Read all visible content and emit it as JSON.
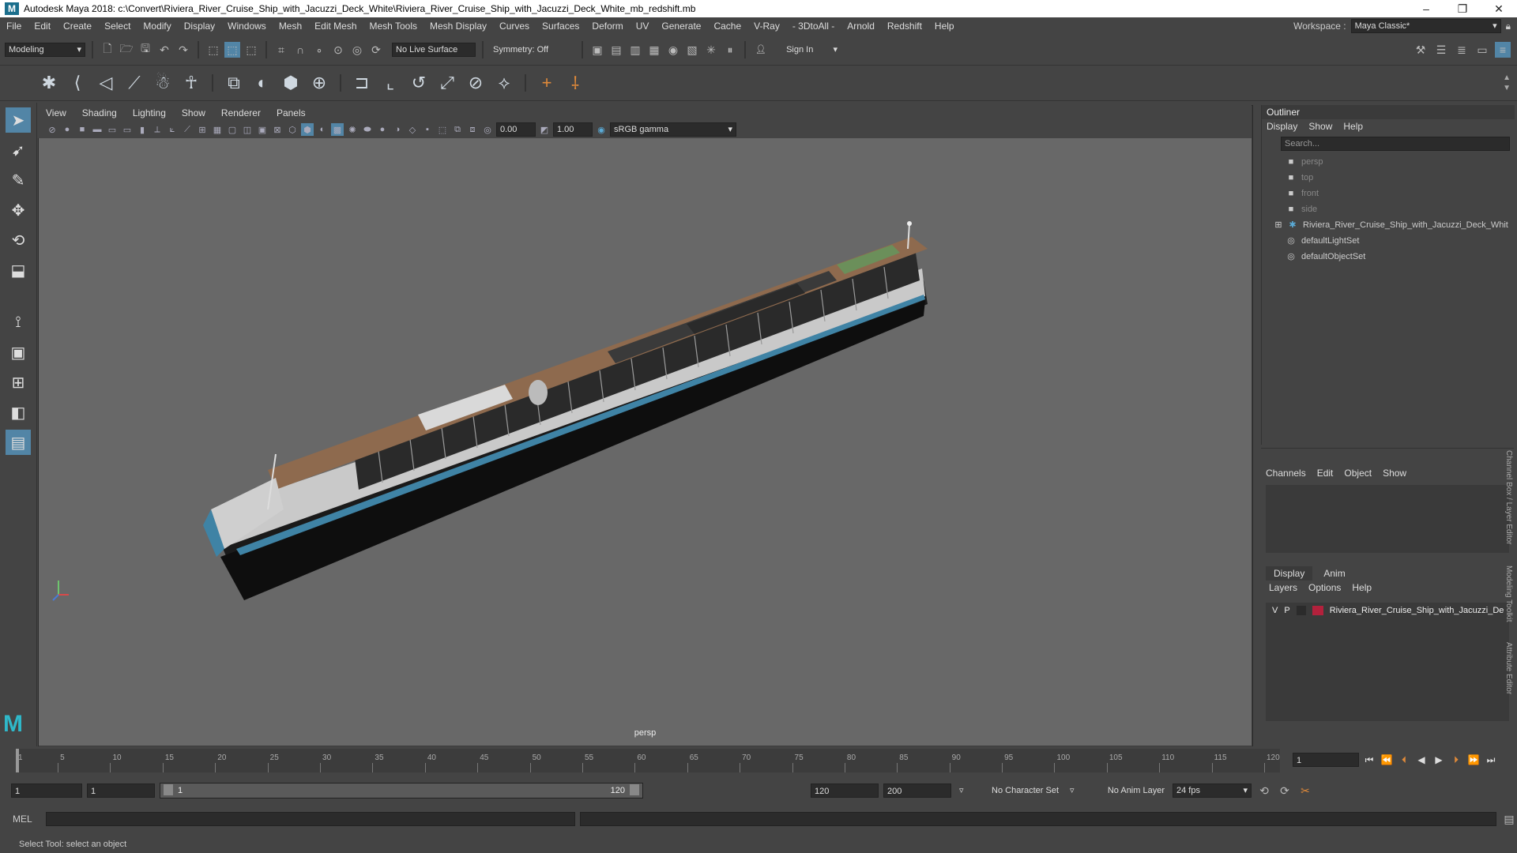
{
  "window": {
    "title": "Autodesk Maya 2018: c:\\Convert\\Riviera_River_Cruise_Ship_with_Jacuzzi_Deck_White\\Riviera_River_Cruise_Ship_with_Jacuzzi_Deck_White_mb_redshift.mb",
    "logo": "M",
    "minimize": "–",
    "maximize": "❐",
    "close": "✕"
  },
  "menubar": {
    "items": [
      "File",
      "Edit",
      "Create",
      "Select",
      "Modify",
      "Display",
      "Windows",
      "Mesh",
      "Edit Mesh",
      "Mesh Tools",
      "Mesh Display",
      "Curves",
      "Surfaces",
      "Deform",
      "UV",
      "Generate",
      "Cache",
      "V-Ray",
      "- 3DtoAll -",
      "Arnold",
      "Redshift",
      "Help"
    ],
    "workspace_label": "Workspace :",
    "workspace_value": "Maya Classic*"
  },
  "statusline": {
    "mode": "Modeling",
    "live_surface": "No Live Surface",
    "symmetry": "Symmetry: Off",
    "sign_in": "Sign In"
  },
  "viewport": {
    "menu": [
      "View",
      "Shading",
      "Lighting",
      "Show",
      "Renderer",
      "Panels"
    ],
    "exposure": "0.00",
    "gamma": "1.00",
    "color_space": "sRGB gamma",
    "camera_label": "persp"
  },
  "outliner": {
    "title": "Outliner",
    "menu": [
      "Display",
      "Show",
      "Help"
    ],
    "search_placeholder": "Search...",
    "items": [
      {
        "label": "persp",
        "icon": "camera-icon",
        "dim": true
      },
      {
        "label": "top",
        "icon": "camera-icon",
        "dim": true
      },
      {
        "label": "front",
        "icon": "camera-icon",
        "dim": true
      },
      {
        "label": "side",
        "icon": "camera-icon",
        "dim": true
      },
      {
        "label": "Riviera_River_Cruise_Ship_with_Jacuzzi_Deck_Whit",
        "icon": "group-icon",
        "dim": false
      },
      {
        "label": "defaultLightSet",
        "icon": "set-icon",
        "dim": false
      },
      {
        "label": "defaultObjectSet",
        "icon": "set-icon",
        "dim": false
      }
    ]
  },
  "channelbox": {
    "menu": [
      "Channels",
      "Edit",
      "Object",
      "Show"
    ]
  },
  "layers": {
    "tabs": [
      "Display",
      "Anim"
    ],
    "menu": [
      "Layers",
      "Options",
      "Help"
    ],
    "row": {
      "v": "V",
      "p": "P",
      "name": "Riviera_River_Cruise_Ship_with_Jacuzzi_De",
      "color": "#b3213c"
    }
  },
  "sidetabs": [
    "Channel Box / Layer Editor",
    "Modeling Toolkit",
    "Attribute Editor"
  ],
  "timeline": {
    "ticks": [
      1,
      5,
      10,
      15,
      20,
      25,
      30,
      35,
      40,
      45,
      50,
      55,
      60,
      65,
      70,
      75,
      80,
      85,
      90,
      95,
      100,
      105,
      110,
      115,
      120
    ],
    "current_frame": "1"
  },
  "range": {
    "start": "1",
    "anim_start": "1",
    "slider_start": "1",
    "slider_end": "120",
    "end": "120",
    "anim_end": "200",
    "character_set": "No Character Set",
    "anim_layer": "No Anim Layer",
    "fps": "24 fps"
  },
  "cmdline": {
    "label": "MEL"
  },
  "helpline": {
    "text": "Select Tool: select an object"
  }
}
